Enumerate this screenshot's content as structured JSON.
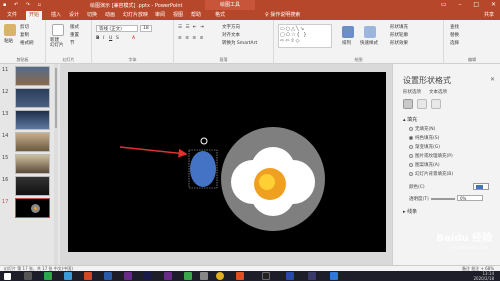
{
  "titlebar": {
    "doc_title": "绘图演示 [兼容模式] .pptx  -  PowerPoint",
    "context_header": "绘图工具",
    "qat": "▪ ↶ ↷ ▫"
  },
  "tabs": [
    "文件",
    "开始",
    "插入",
    "设计",
    "切换",
    "动画",
    "幻灯片放映",
    "审阅",
    "视图",
    "帮助",
    "格式"
  ],
  "active_tab": "开始",
  "tell_me": "♀ 操作说明搜索",
  "share": "共享",
  "ribbon": {
    "clipboard": {
      "label": "剪贴板",
      "paste": "粘贴",
      "cut": "剪切",
      "copy": "复制",
      "painter": "格式刷"
    },
    "slides": {
      "label": "幻灯片",
      "new": "新建\n幻灯片",
      "layout": "版式",
      "reset": "重置",
      "section": "节"
    },
    "font": {
      "label": "字体",
      "name": "等线 (正文)",
      "size": "18"
    },
    "paragraph": {
      "label": "段落",
      "text_dir": "文字方向",
      "align": "对齐文本",
      "smartart": "转换为 SmartArt"
    },
    "drawing": {
      "label": "绘图",
      "arrange": "排列",
      "quick": "快速样式",
      "fill": "形状填充",
      "outline": "形状轮廓",
      "effect": "形状效果"
    },
    "editing": {
      "label": "编辑",
      "find": "查找",
      "replace": "替换",
      "select": "选择"
    }
  },
  "thumbnails": [
    {
      "num": "11"
    },
    {
      "num": "12"
    },
    {
      "num": "13"
    },
    {
      "num": "14"
    },
    {
      "num": "15"
    },
    {
      "num": "16"
    },
    {
      "num": "17",
      "selected": true
    }
  ],
  "panel": {
    "title": "设置形状格式",
    "tab1": "形状选项",
    "tab2": "文本选项",
    "fill_section": "▴ 填充",
    "options": [
      {
        "label": "无填充(N)",
        "on": false
      },
      {
        "label": "纯色填充(S)",
        "on": true
      },
      {
        "label": "渐变填充(G)",
        "on": false
      },
      {
        "label": "图片或纹理填充(P)",
        "on": false
      },
      {
        "label": "图案填充(A)",
        "on": false
      },
      {
        "label": "幻灯片背景填充(B)",
        "on": false
      }
    ],
    "color_label": "颜色(C)",
    "transparency_label": "透明度(T)",
    "transparency_value": "0%",
    "line_section": "▸ 线条"
  },
  "status": {
    "left": "幻灯片 第 17 张，共 17 张    中文(中国)",
    "right": "备注   批注       +  68%"
  },
  "clock": {
    "time": "13:14",
    "date": "2020/2/18"
  },
  "watermark": "Baidu 经验",
  "watermark_sub": "jingyan.baidu.com",
  "colors": {
    "accent": "#b7472a",
    "shape_fill": "#4472c4",
    "arrow": "#e03030",
    "egg_yolk": "#f0a020"
  }
}
